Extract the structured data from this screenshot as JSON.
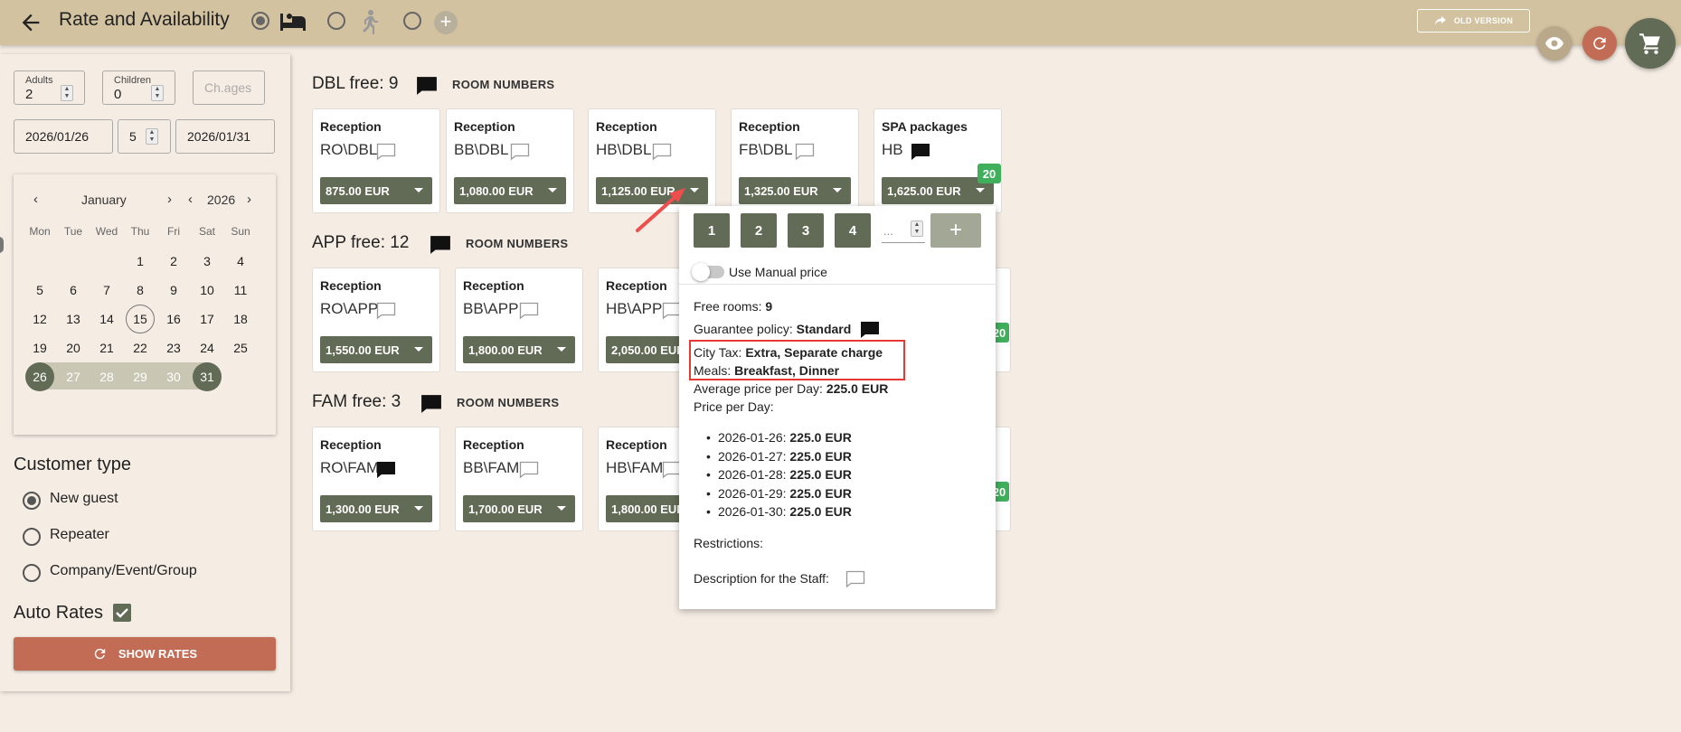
{
  "header": {
    "title": "Rate and Availability",
    "old_version_label": "OLD VERSION",
    "mode_options": [
      "bed-icon",
      "walking-person-icon",
      "add-icon"
    ]
  },
  "search": {
    "adults_label": "Adults",
    "adults_value": "2",
    "children_label": "Children",
    "children_value": "0",
    "ch_ages_placeholder": "Ch.ages",
    "date_from": "2026/01/26",
    "nights": "5",
    "date_to": "2026/01/31"
  },
  "calendar": {
    "month": "January",
    "year": "2026",
    "weekdays": [
      "Mon",
      "Tue",
      "Wed",
      "Thu",
      "Fri",
      "Sat",
      "Sun"
    ],
    "weeks": [
      [
        "",
        "",
        "",
        "1",
        "2",
        "3",
        "4"
      ],
      [
        "5",
        "6",
        "7",
        "8",
        "9",
        "10",
        "11"
      ],
      [
        "12",
        "13",
        "14",
        "15",
        "16",
        "17",
        "18"
      ],
      [
        "19",
        "20",
        "21",
        "22",
        "23",
        "24",
        "25"
      ],
      [
        "26",
        "27",
        "28",
        "29",
        "30",
        "31",
        ""
      ]
    ],
    "today": "15",
    "range_start": "26",
    "range_end": "31"
  },
  "customer": {
    "title": "Customer type",
    "options": [
      "New guest",
      "Repeater",
      "Company/Event/Group"
    ],
    "selected": "New guest"
  },
  "auto_rates": {
    "label": "Auto Rates",
    "checked": true
  },
  "show_rates_label": "SHOW RATES",
  "room_numbers_label": "ROOM NUMBERS",
  "groups": [
    {
      "title": "DBL free: 9",
      "cards": [
        {
          "category": "Reception",
          "code": "RO\\DBL",
          "price": "875.00 EUR"
        },
        {
          "category": "Reception",
          "code": "BB\\DBL",
          "price": "1,080.00 EUR"
        },
        {
          "category": "Reception",
          "code": "HB\\DBL",
          "price": "1,125.00 EUR"
        },
        {
          "category": "Reception",
          "code": "FB\\DBL",
          "price": "1,325.00 EUR"
        },
        {
          "category": "SPA packages",
          "code": "HB",
          "price": "1,625.00 EUR",
          "badge": "20"
        }
      ]
    },
    {
      "title": "APP free: 12",
      "cards": [
        {
          "category": "Reception",
          "code": "RO\\APP",
          "price": "1,550.00 EUR"
        },
        {
          "category": "Reception",
          "code": "BB\\APP",
          "price": "1,800.00 EUR"
        },
        {
          "category": "Reception",
          "code": "HB\\APP",
          "price": "2,050.00 EUR"
        }
      ],
      "hidden_badge": "20"
    },
    {
      "title": "FAM free: 3",
      "cards": [
        {
          "category": "Reception",
          "code": "RO\\FAM",
          "price": "1,300.00 EUR"
        },
        {
          "category": "Reception",
          "code": "BB\\FAM",
          "price": "1,700.00 EUR"
        },
        {
          "category": "Reception",
          "code": "HB\\FAM",
          "price": "1,800.00 EUR"
        }
      ],
      "hidden_badge": "20"
    }
  ],
  "popup": {
    "quantities": [
      "1",
      "2",
      "3",
      "4"
    ],
    "qty_input_placeholder": "...",
    "manual_price_label": "Use Manual price",
    "free_rooms_label": "Free rooms:",
    "free_rooms_value": "9",
    "guarantee_label": "Guarantee policy:",
    "guarantee_value": "Standard",
    "city_tax_label": "City Tax:",
    "city_tax_value": "Extra, Separate charge",
    "meals_label": "Meals:",
    "meals_value": "Breakfast, Dinner",
    "avg_price_label": "Average price per Day:",
    "avg_price_value": "225.0 EUR",
    "price_per_day_label": "Price per Day:",
    "days": [
      {
        "date": "2026-01-26:",
        "price": "225.0 EUR"
      },
      {
        "date": "2026-01-27:",
        "price": "225.0 EUR"
      },
      {
        "date": "2026-01-28:",
        "price": "225.0 EUR"
      },
      {
        "date": "2026-01-29:",
        "price": "225.0 EUR"
      },
      {
        "date": "2026-01-30:",
        "price": "225.0 EUR"
      }
    ],
    "restrictions_label": "Restrictions:",
    "staff_desc_label": "Description for the Staff:"
  },
  "colors": {
    "topbar": "#d3c2a0",
    "price_button": "#626b55",
    "show_rates": "#c26c56",
    "badge": "#3faf5c",
    "highlight": "#e53935",
    "fab_eye": "#b9a88a",
    "fab_refresh": "#c26c56",
    "fab_cart": "#626b55"
  }
}
